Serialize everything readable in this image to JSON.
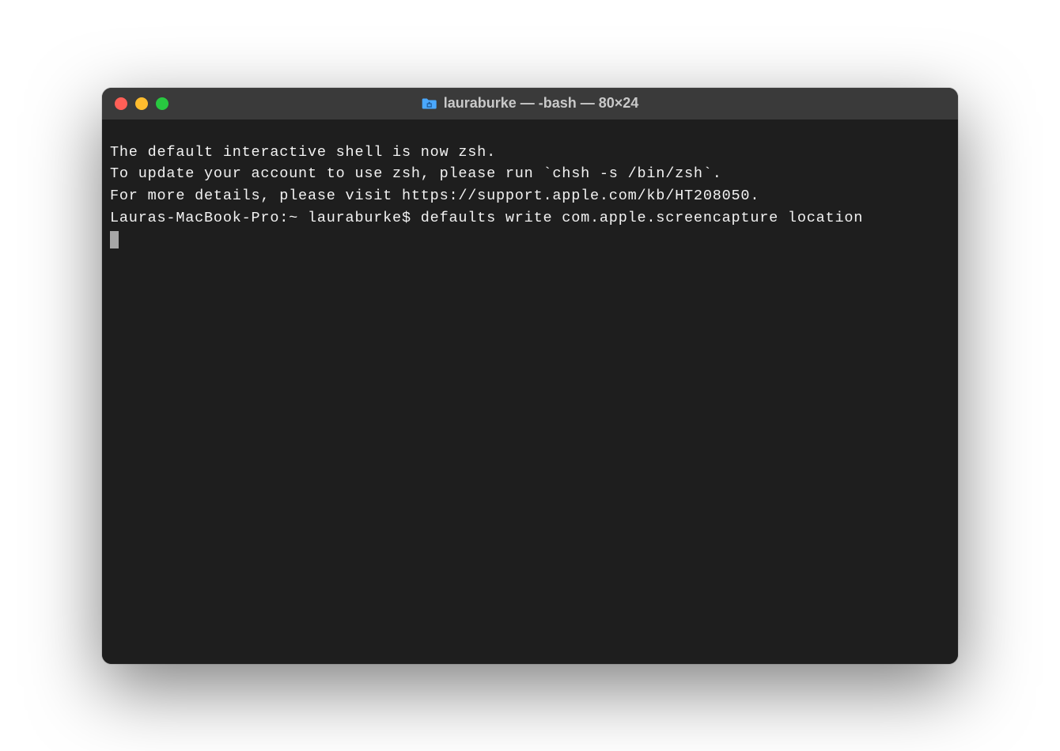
{
  "window": {
    "title": "lauraburke — -bash — 80×24"
  },
  "terminal": {
    "lines": [
      "The default interactive shell is now zsh.",
      "To update your account to use zsh, please run `chsh -s /bin/zsh`.",
      "For more details, please visit https://support.apple.com/kb/HT208050."
    ],
    "prompt": "Lauras-MacBook-Pro:~ lauraburke$ ",
    "command": "defaults write com.apple.screencapture location "
  },
  "colors": {
    "window_bg": "#1e1e1e",
    "titlebar_bg": "#3a3a3a",
    "text": "#f2f2f2",
    "traffic_close": "#ff5f57",
    "traffic_minimize": "#febc2e",
    "traffic_zoom": "#28c840",
    "folder_icon": "#4aa8ff"
  }
}
